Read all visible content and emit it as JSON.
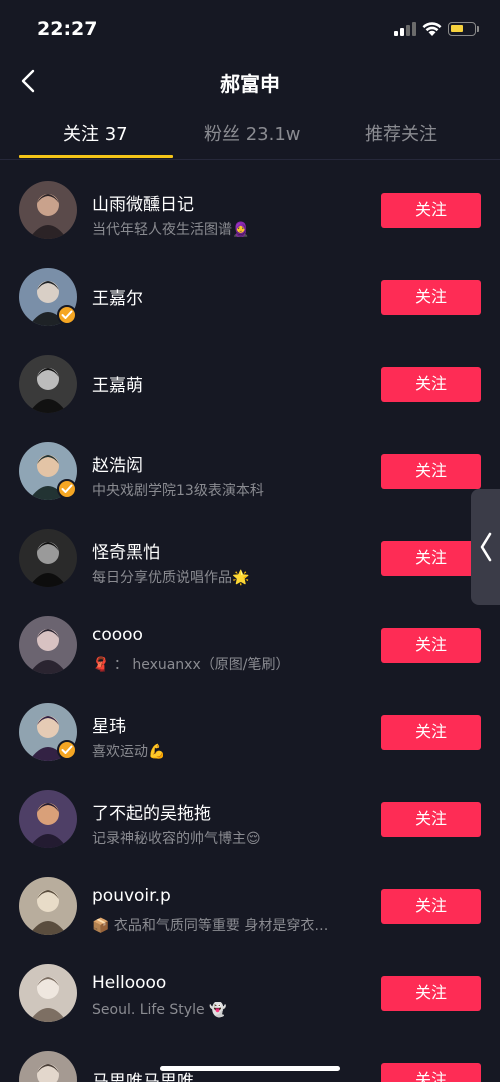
{
  "status_bar": {
    "time": "22:27",
    "battery_level": 0.55,
    "battery_color": "#f7d23e"
  },
  "header": {
    "title": "郝富申"
  },
  "tabs": [
    {
      "label": "关注 37",
      "active": true
    },
    {
      "label": "粉丝 23.1w",
      "active": false
    },
    {
      "label": "推荐关注",
      "active": false
    }
  ],
  "colors": {
    "accent": "#f5c518",
    "follow_button": "#fe2c55",
    "background": "#161823",
    "verified": "#f5a623"
  },
  "users": [
    {
      "name": "山雨微醺日记",
      "desc": "当代年轻人夜生活图谱🧕",
      "verified": false,
      "follow_label": "关注",
      "avatar_icon": "avatar-photo"
    },
    {
      "name": "王嘉尔",
      "desc": "",
      "verified": true,
      "follow_label": "关注",
      "avatar_icon": "avatar-photo"
    },
    {
      "name": "王嘉萌",
      "desc": "",
      "verified": false,
      "follow_label": "关注",
      "avatar_icon": "avatar-photo"
    },
    {
      "name": "赵浩闳",
      "desc": "中央戏剧学院13级表演本科",
      "verified": true,
      "follow_label": "关注",
      "avatar_icon": "avatar-photo"
    },
    {
      "name": "怪奇黑怕",
      "desc": "每日分享优质说唱作品🌟",
      "verified": false,
      "follow_label": "关注",
      "avatar_icon": "avatar-photo"
    },
    {
      "name": "coooo",
      "desc": "🧣 ： hexuanxx（原图/笔刷）",
      "verified": false,
      "follow_label": "关注",
      "avatar_icon": "avatar-illustration"
    },
    {
      "name": "星玮",
      "desc": "喜欢运动💪",
      "verified": true,
      "follow_label": "关注",
      "avatar_icon": "avatar-photo"
    },
    {
      "name": "了不起的吴拖拖",
      "desc": "记录神秘收容的帅气博主😌",
      "verified": false,
      "follow_label": "关注",
      "avatar_icon": "avatar-illustration"
    },
    {
      "name": "pouvoir.p",
      "desc": "📦 衣品和气质同等重要  身材是穿衣…",
      "verified": false,
      "follow_label": "关注",
      "avatar_icon": "avatar-photo"
    },
    {
      "name": "Helloooo",
      "desc": "Seoul. Life Style 👻",
      "verified": false,
      "follow_label": "关注",
      "avatar_icon": "avatar-photo"
    },
    {
      "name": "马思唯马思唯",
      "desc": "",
      "verified": false,
      "follow_label": "关注",
      "avatar_icon": "avatar-photo"
    }
  ]
}
